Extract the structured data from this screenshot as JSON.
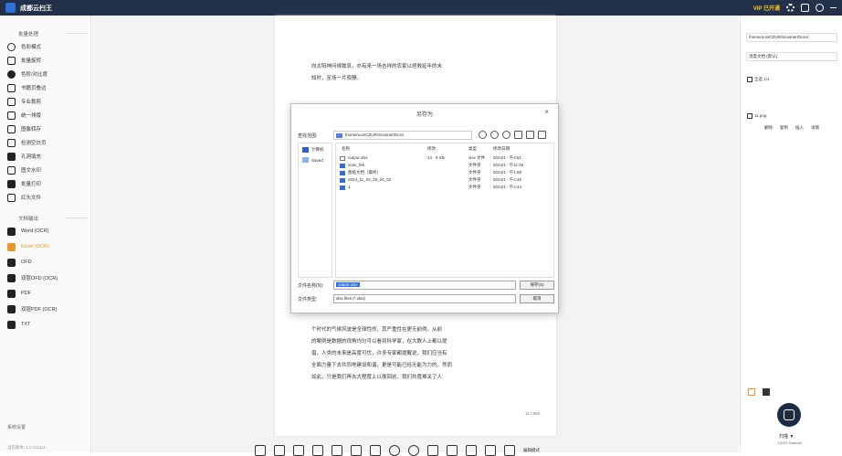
{
  "app": {
    "title": "成都云扫王",
    "vip_label": "VIP 已开通"
  },
  "sidebar": {
    "section1": "批量处理",
    "items": [
      "色彩模式",
      "批量旋转",
      "色阶/对比度",
      "书籍页叠边",
      "专业裁剪",
      "统一排版",
      "图像转存",
      "检测空白页",
      "孔洞填充",
      "图文水印",
      "批量打印",
      "红头文件"
    ],
    "section2": "文档输出",
    "outputs": [
      "Word (OCR)",
      "Excel (OCR)",
      "OFD",
      "双层OFD (OCR)",
      "PDF",
      "双层PDF (OCR)",
      "TXT"
    ],
    "bottom_label": "系统设置",
    "version": "当前版本: 1.0.241111"
  },
  "page": {
    "text_top": [
      "向太阳神问候致哀，亦有来一场吉祥的农家以拯救延年的末",
      "知时，至场一片寂静。"
    ],
    "text_bottom": [
      "个时代的气候风波是全球性的，其严重性在更无前例。从前",
      "的案例是数据的视角均匀可以看到科学家，在大数人上都以提",
      "倡，人类的未来是高度可忧，许多专家都提醒说，我们应当有",
      "全面力量下去共同地建设和谐，更是可能已经无能为力的。然而",
      "如此，只是我们再去大程度上以挽回这，我们共度难关了人"
    ],
    "page_number": "11 / 996"
  },
  "dialog": {
    "title": "另存为",
    "path": "/home/uos/CZUR/Scanner/Docs",
    "places": [
      "计算机",
      "Saved"
    ],
    "columns": [
      "名称",
      "修改",
      "类型",
      "修改日期"
    ],
    "files": [
      {
        "name": "output.xlsx",
        "col2": "14 · 9 KB",
        "type": "xlsx 文件",
        "date": "2024/1 · 午4:51"
      },
      {
        "name": "scan_feb",
        "col2": "",
        "type": "文件夹",
        "date": "2024/1 · 午11:46"
      },
      {
        "name": "图纸文档（最终）",
        "col2": "",
        "type": "文件夹",
        "date": "2024/1 · 午1:58"
      },
      {
        "name": "2024_11_04_15_26_52",
        "col2": "",
        "type": "文件夹",
        "date": "2024/1 · 午4:48"
      },
      {
        "name": "1",
        "col2": "",
        "type": "文件夹",
        "date": "2024/1 · 午4:44"
      }
    ],
    "filename_label": "文件名称(N):",
    "filename_value": "output.xlsx",
    "filetype_label": "文件类型:",
    "filetype_value": "xlsx files (*.xlsx)",
    "save_button": "保存(S)",
    "cancel_button": "取消"
  },
  "toolbar": {
    "last_label": "编辑模式"
  },
  "rightpanel": {
    "path_value": "/home/uos/CZUR/Scanner/Docs/",
    "doc_select": "湿度文档 (默认)",
    "select_all": "全选  1/1",
    "file_name": "11.png",
    "actions": [
      "删除",
      "复制",
      "插入",
      "详情"
    ],
    "scan_label": "扫描 ▼",
    "scan_sub": "CZUR Scanner"
  }
}
